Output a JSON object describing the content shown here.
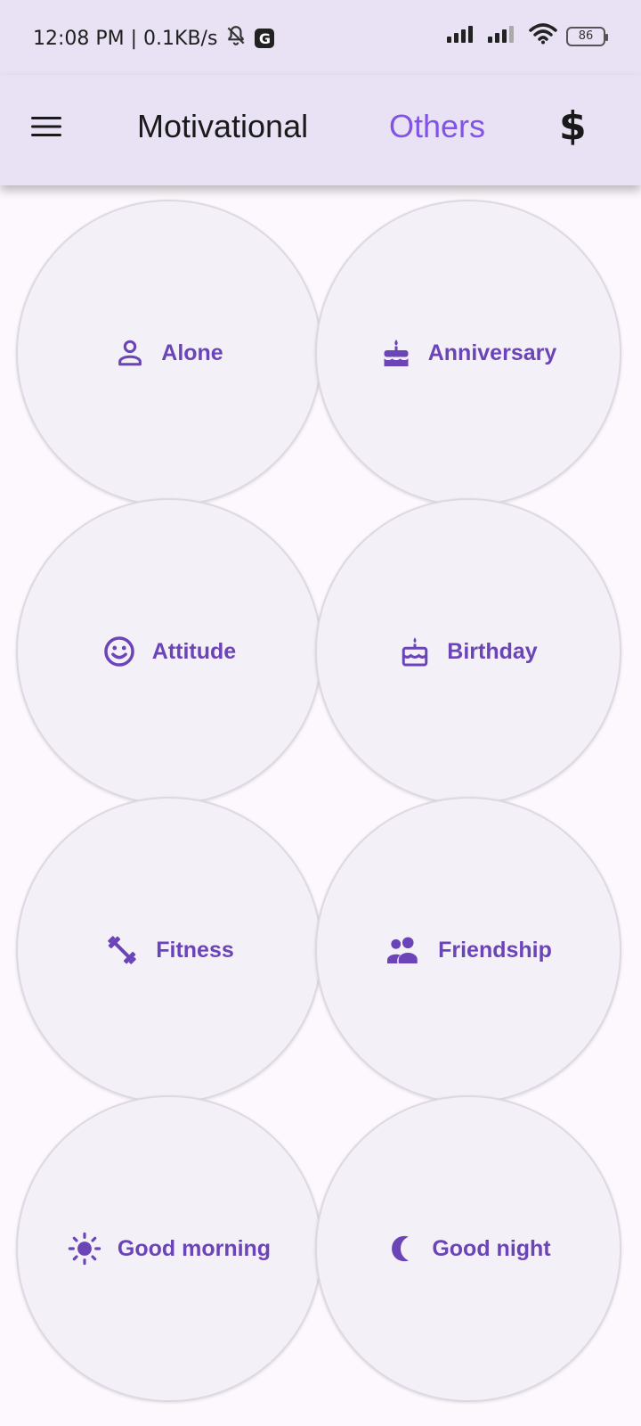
{
  "status_bar": {
    "time_speed": "12:08 PM | 0.1KB/s",
    "g_badge": "G",
    "battery": "86"
  },
  "app_bar": {
    "tabs": [
      {
        "label": "Motivational"
      },
      {
        "label": "Others"
      }
    ],
    "currency_symbol": "$",
    "active_color": "#8154e6"
  },
  "categories": [
    {
      "label": "Alone",
      "icon": "person-icon"
    },
    {
      "label": "Anniversary",
      "icon": "cake-icon"
    },
    {
      "label": "Attitude",
      "icon": "smiley-icon"
    },
    {
      "label": "Birthday",
      "icon": "birthday-cake-icon"
    },
    {
      "label": "Fitness",
      "icon": "dumbbell-icon"
    },
    {
      "label": "Friendship",
      "icon": "people-icon"
    },
    {
      "label": "Good morning",
      "icon": "sun-icon"
    },
    {
      "label": "Good night",
      "icon": "moon-icon"
    }
  ],
  "theme": {
    "accent": "#6b44b7",
    "bar_bg": "#e9e2f4",
    "card_bg": "#f4f0f8"
  }
}
